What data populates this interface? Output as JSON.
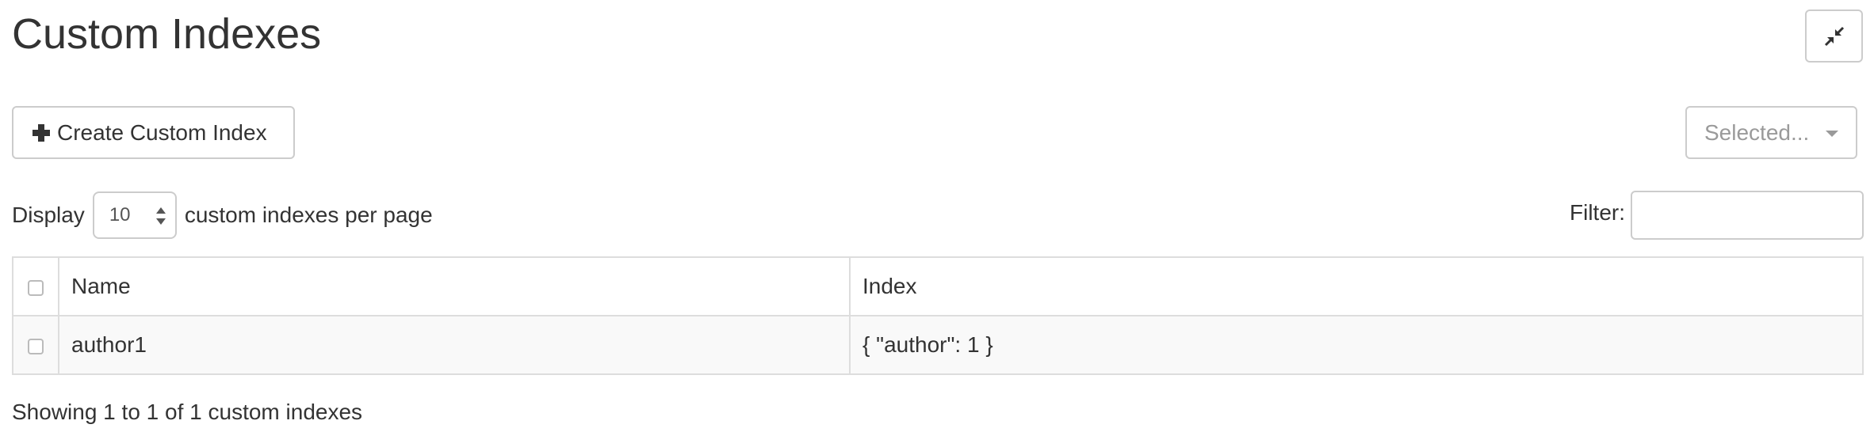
{
  "page": {
    "title": "Custom Indexes"
  },
  "toolbar": {
    "collapse_icon": "compress-arrows-icon",
    "create_label": "Create Custom Index",
    "create_icon": "plus-icon",
    "selected_label": "Selected...",
    "selected_icon": "caret-down-icon"
  },
  "length": {
    "prefix": "Display",
    "value": "10",
    "suffix": "custom indexes per page"
  },
  "filter": {
    "label": "Filter:",
    "value": "",
    "placeholder": ""
  },
  "table": {
    "columns": [
      "",
      "Name",
      "Index"
    ],
    "rows": [
      {
        "name": "author1",
        "index": "{ \"author\": 1 }"
      }
    ]
  },
  "info": {
    "text": "Showing 1 to 1 of 1 custom indexes"
  },
  "colors": {
    "text": "#333333",
    "border": "#cccccc",
    "muted": "#9a9a9a",
    "row_stripe": "#f9f9f9"
  }
}
